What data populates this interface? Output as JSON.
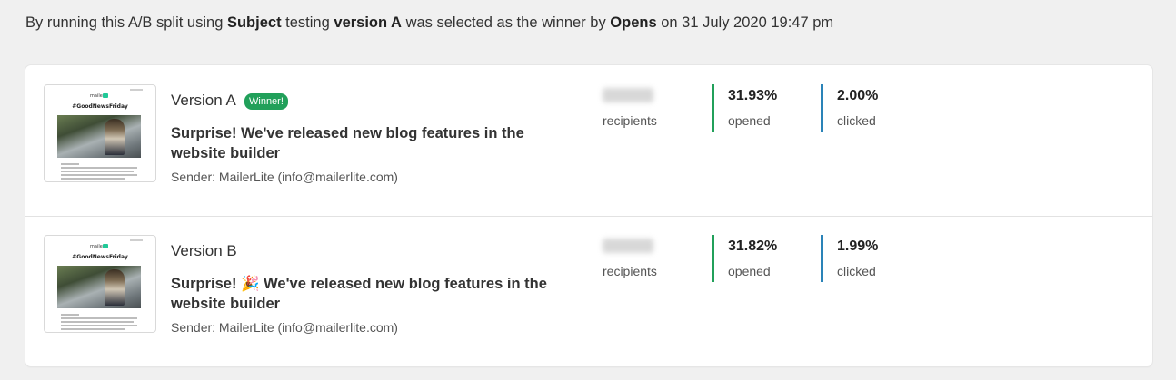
{
  "summary": {
    "t1": "By running this A/B split using",
    "criteria": "Subject",
    "t2": "testing",
    "version": "version A",
    "t3": "was selected as the winner by",
    "metric": "Opens",
    "t4": "on 31 July 2020 19:47 pm"
  },
  "versions": [
    {
      "title": "Version A",
      "winner_badge": "Winner!",
      "subject": "Surprise! We've released new blog features in the website builder",
      "sender": "Sender: MailerLite (info@mailerlite.com)",
      "thumb": {
        "logo": "mailer",
        "hashtag": "#GoodNewsFriday"
      },
      "recipients_label": "recipients",
      "opened": "31.93%",
      "opened_label": "opened",
      "clicked": "2.00%",
      "clicked_label": "clicked"
    },
    {
      "title": "Version B",
      "subject": "Surprise! 🎉 We've released new blog features in the website builder",
      "sender": "Sender: MailerLite (info@mailerlite.com)",
      "thumb": {
        "logo": "mailer",
        "hashtag": "#GoodNewsFriday"
      },
      "recipients_label": "recipients",
      "opened": "31.82%",
      "opened_label": "opened",
      "clicked": "1.99%",
      "clicked_label": "clicked"
    }
  ],
  "colors": {
    "winner_badge": "#21a05a",
    "opened_bar": "#21a05a",
    "clicked_bar": "#2a83b8"
  }
}
